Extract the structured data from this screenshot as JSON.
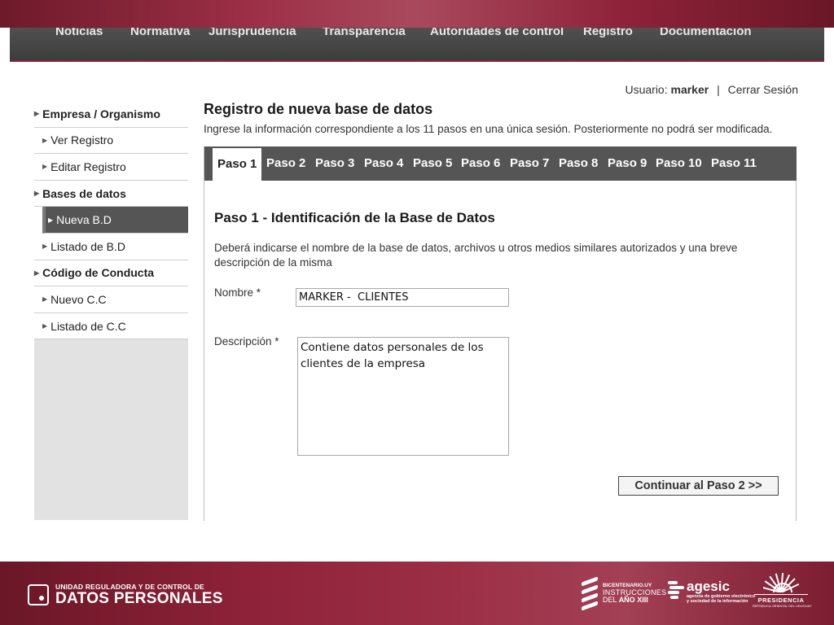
{
  "nav": {
    "items": [
      "Noticias",
      "Normativa",
      "Jurisprudencia",
      "Transparencia",
      "Autoridades de control",
      "Registro",
      "Documentación"
    ]
  },
  "user": {
    "label": "Usuario:",
    "name": "marker",
    "separator": "|",
    "logout": "Cerrar Sesión"
  },
  "sidebar": {
    "items": [
      {
        "label": "Empresa / Organismo",
        "level": "top"
      },
      {
        "label": "Ver Registro",
        "level": "sub"
      },
      {
        "label": "Editar Registro",
        "level": "sub"
      },
      {
        "label": "Bases de datos",
        "level": "top"
      },
      {
        "label": "Nueva B.D",
        "level": "sub",
        "active": true
      },
      {
        "label": "Listado de B.D",
        "level": "sub"
      },
      {
        "label": "Código de Conducta",
        "level": "top"
      },
      {
        "label": "Nuevo C.C",
        "level": "sub"
      },
      {
        "label": "Listado de C.C",
        "level": "sub"
      }
    ]
  },
  "page": {
    "title": "Registro de nueva base de datos",
    "subtitle": "Ingrese la información correspondiente a los 11 pasos en una única sesión. Posteriormente no podrá ser modificada."
  },
  "tabs": [
    "Paso 1",
    "Paso 2",
    "Paso 3",
    "Paso 4",
    "Paso 5",
    "Paso 6",
    "Paso 7",
    "Paso 8",
    "Paso 9",
    "Paso 10",
    "Paso 11"
  ],
  "active_tab": "Paso 1",
  "step": {
    "title": "Paso 1 - Identificación de la Base de Datos",
    "description": "Deberá indicarse el nombre de la base de datos, archivos u otros medios similares autorizados y una breve descripción de la misma"
  },
  "form": {
    "name_label": "Nombre *",
    "name_value": "MARKER -  CLIENTES",
    "desc_label": "Descripción *",
    "desc_value": "Contiene datos personales de los clientes de la empresa",
    "continue_label": "Continuar al Paso 2 >>"
  },
  "footer": {
    "brand_small": "UNIDAD REGULADORA Y DE CONTROL DE",
    "brand_big": "DATOS PERSONALES",
    "bicent_line1": "BICENTENARIO.UY",
    "bicent_line2": "INSTRUCCIONES",
    "bicent_line3a": "DEL ",
    "bicent_line3b": "AÑO XIII",
    "agesic_word": "agesic",
    "agesic_tag1": "agencia de gobierno electrónico",
    "agesic_tag2": "y sociedad de la información",
    "pres_word": "PRESIDENCIA",
    "pres_sub": "REPÚBLICA ORIENTAL DEL URUGUAY"
  },
  "colors": {
    "brand": "#8e2238",
    "nav_bg": "#4a4a4a",
    "tab_bg": "#555555",
    "sidebar_bg": "#e2e2e2"
  }
}
